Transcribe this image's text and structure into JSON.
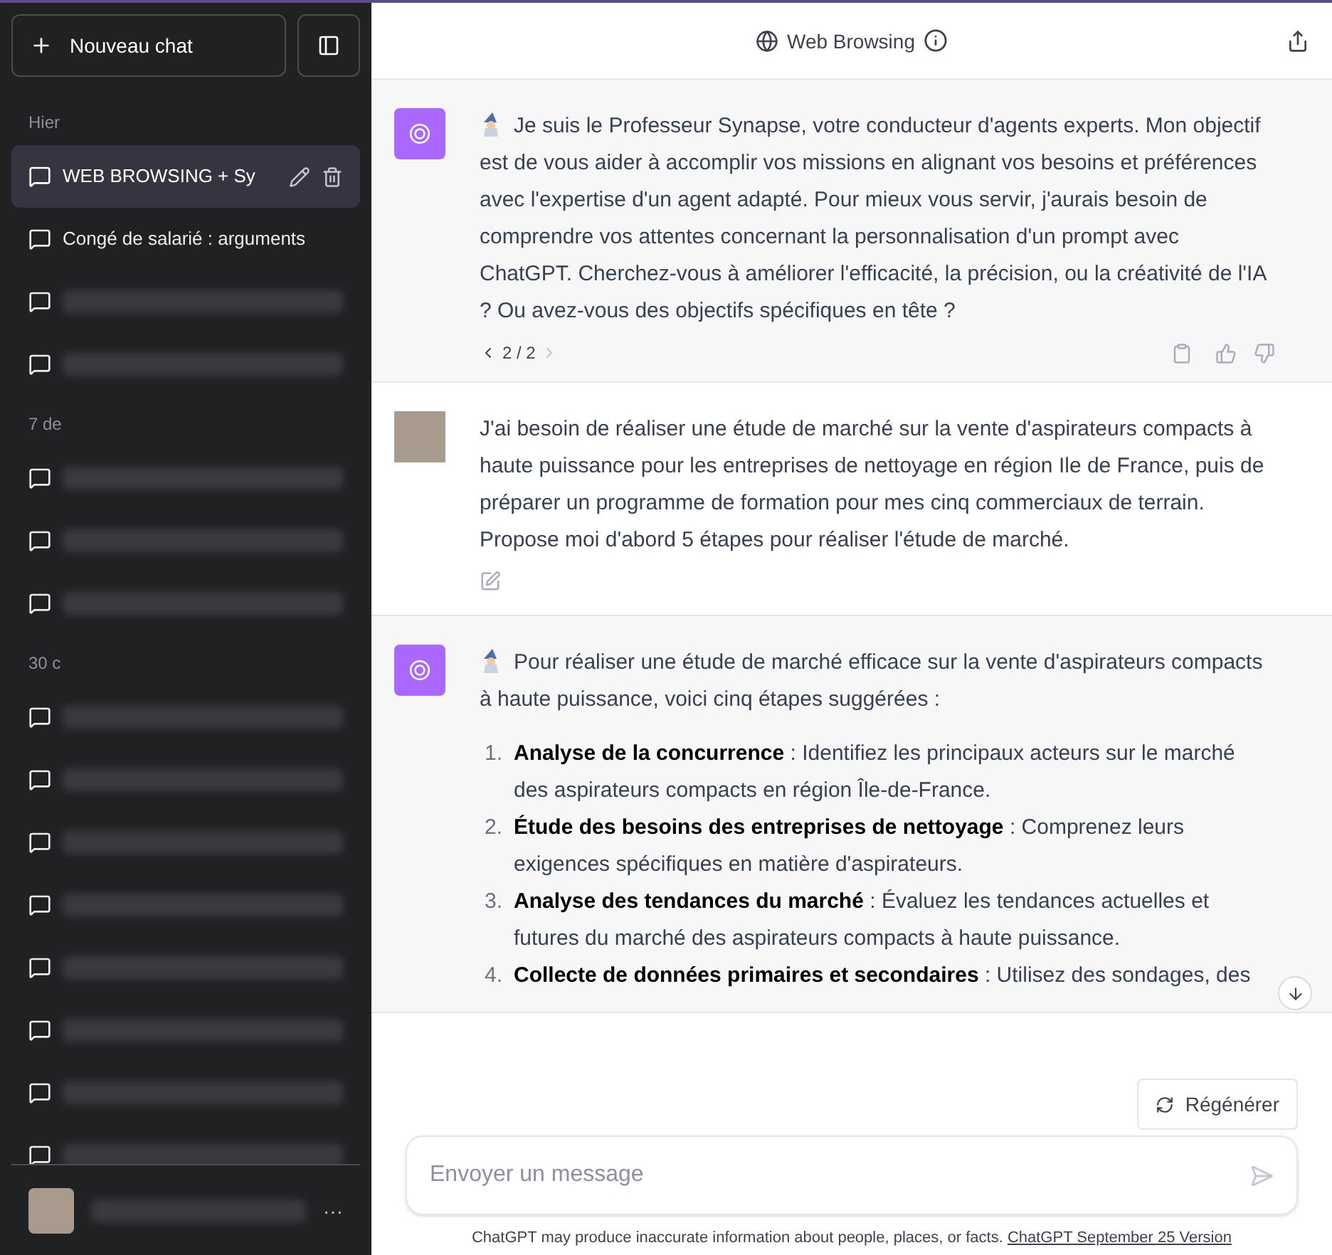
{
  "sidebar": {
    "new_chat": "Nouveau chat",
    "sections": [
      {
        "label": "Hier",
        "items": [
          {
            "kind": "chat",
            "title": "WEB BROWSING + Sy",
            "selected": true
          },
          {
            "kind": "chat",
            "title": "Congé de salarié : arguments",
            "selected": false
          },
          {
            "kind": "blurred",
            "selected": false
          },
          {
            "kind": "blurred",
            "selected": false
          }
        ]
      },
      {
        "label": "7 de",
        "items": [
          {
            "kind": "blurred",
            "selected": false
          },
          {
            "kind": "blurred",
            "selected": false
          },
          {
            "kind": "blurred",
            "selected": false
          }
        ]
      },
      {
        "label": "30 c",
        "items": [
          {
            "kind": "blurred",
            "selected": false
          },
          {
            "kind": "blurred",
            "selected": false
          },
          {
            "kind": "blurred",
            "selected": false
          },
          {
            "kind": "blurred",
            "selected": false
          },
          {
            "kind": "blurred",
            "selected": false
          },
          {
            "kind": "blurred",
            "selected": false
          },
          {
            "kind": "blurred",
            "selected": false
          },
          {
            "kind": "blurred",
            "selected": false
          }
        ]
      }
    ],
    "user_menu": "···"
  },
  "header": {
    "title": "Web Browsing"
  },
  "messages": [
    {
      "kind": "assistant",
      "text": "Je suis le Professeur Synapse, votre conducteur d'agents experts. Mon objectif est de vous aider à accomplir vos missions en alignant vos besoins et préférences avec l'expertise d'un agent adapté. Pour mieux vous servir, j'aurais besoin de comprendre vos attentes concernant la personnalisation d'un prompt avec ChatGPT. Cherchez-vous à améliorer l'efficacité, la précision, ou la créativité de l'IA ? Ou avez-vous des objectifs spécifiques en tête ?",
      "pager": "2 / 2"
    },
    {
      "kind": "user",
      "text": "J'ai besoin de réaliser une étude de marché sur la vente d'aspirateurs compacts à haute puissance pour les entreprises de nettoyage en région Ile de France, puis de préparer un programme de formation pour mes cinq commerciaux de terrain. Propose moi d'abord 5 étapes pour réaliser l'étude de marché."
    },
    {
      "kind": "assistant",
      "text": "Pour réaliser une étude de marché efficace sur la vente d'aspirateurs compacts à haute puissance, voici cinq étapes suggérées :",
      "list": [
        {
          "number": "1.",
          "text": "**Analyse de la concurrence** : Identifiez les principaux acteurs sur le marché des aspirateurs compacts en région Île-de-France."
        },
        {
          "number": "2.",
          "text": "**Étude des besoins des entreprises de nettoyage** : Comprenez leurs exigences spécifiques en matière d'aspirateurs."
        },
        {
          "number": "3.",
          "text": "**Analyse des tendances du marché** : Évaluez les tendances actuelles et futures du marché des aspirateurs compacts à haute puissance."
        },
        {
          "number": "4.",
          "text": "**Collecte de données primaires et secondaires** : Utilisez des sondages, des"
        }
      ]
    }
  ],
  "regenerate": "Régénérer",
  "composer": {
    "placeholder": "Envoyer un message"
  },
  "footer": {
    "text": "ChatGPT may produce inaccurate information about people, places, or facts.",
    "link": "ChatGPT September 25 Version"
  }
}
